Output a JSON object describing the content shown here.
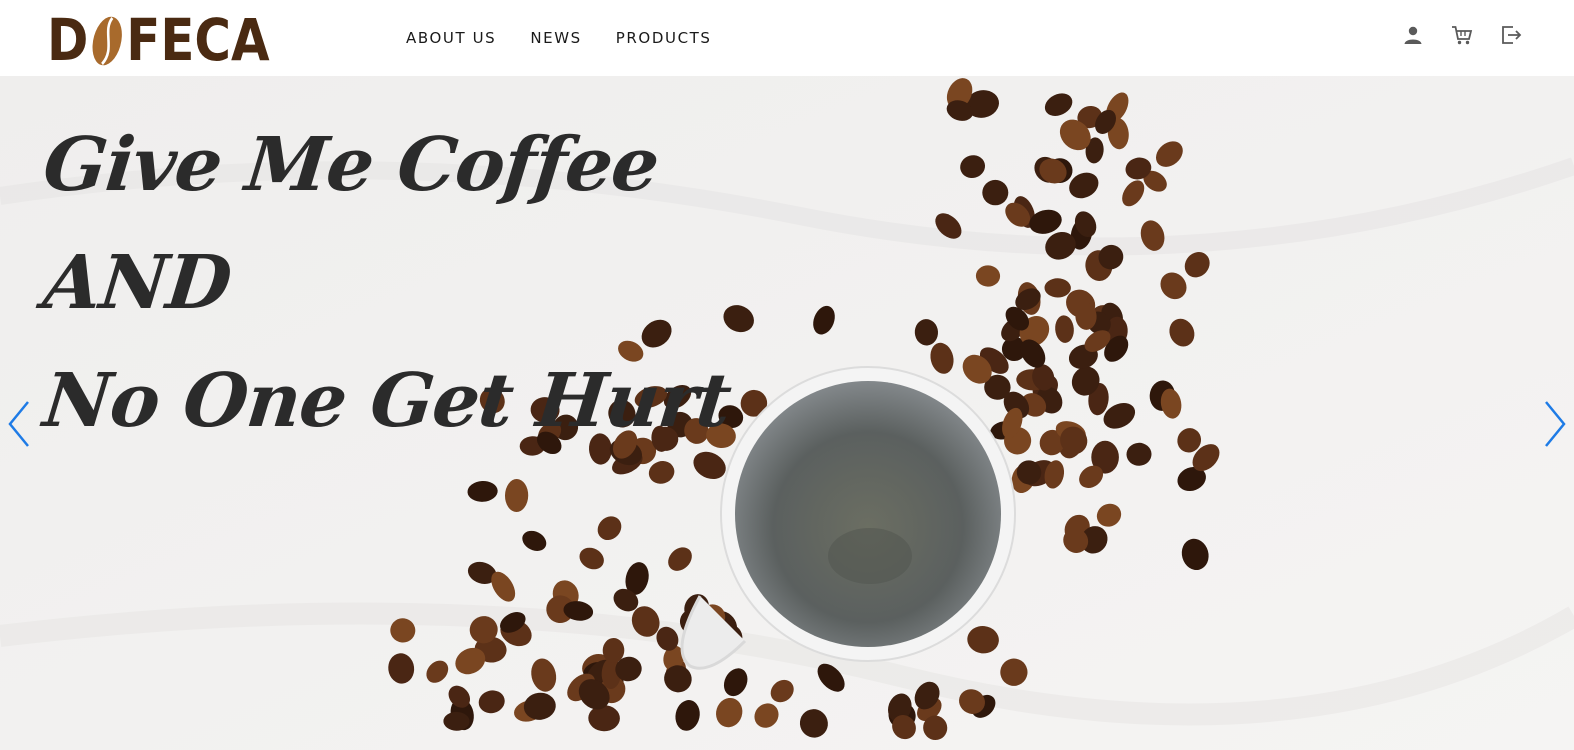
{
  "logo": {
    "text_before": "D",
    "text_after": "FECA",
    "brand_color": "#4a2a12",
    "bean_color": "#a86a2c"
  },
  "nav": {
    "items": [
      {
        "label": "ABOUT US"
      },
      {
        "label": "NEWS"
      },
      {
        "label": "PRODUCTS"
      }
    ]
  },
  "header_icons": [
    "user-icon",
    "cart-icon",
    "logout-icon"
  ],
  "hero": {
    "lines": [
      "Give Me Coffee",
      "AND",
      "No One Get Hurt"
    ],
    "prev_icon": "chevron-left-icon",
    "next_icon": "chevron-right-icon",
    "arrow_color": "#1e7be6"
  }
}
